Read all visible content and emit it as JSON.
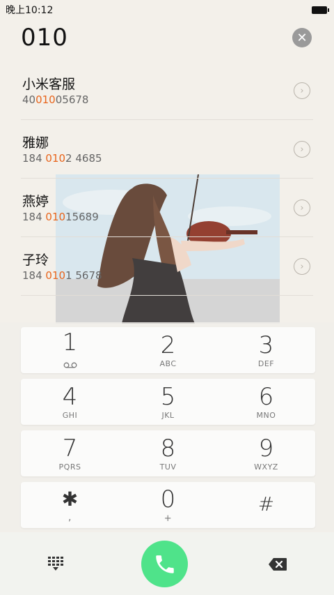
{
  "status_bar": {
    "time": "晚上10:12"
  },
  "dial_input": {
    "value": "010"
  },
  "contacts": [
    {
      "name": "小米客服",
      "num_pre": "40",
      "num_hl": "010",
      "num_post": "05678"
    },
    {
      "name": "雅娜",
      "num_pre": "184 ",
      "num_hl": "010",
      "num_post": "2 4685"
    },
    {
      "name": "燕婷",
      "num_pre": "184 ",
      "num_hl": "010",
      "num_post": "15689"
    },
    {
      "name": "子玲",
      "num_pre": "184 ",
      "num_hl": "010",
      "num_post": "1 5678"
    }
  ],
  "keypad": {
    "rows": [
      [
        {
          "digit": "1",
          "letters": ""
        },
        {
          "digit": "2",
          "letters": "ABC"
        },
        {
          "digit": "3",
          "letters": "DEF"
        }
      ],
      [
        {
          "digit": "4",
          "letters": "GHI"
        },
        {
          "digit": "5",
          "letters": "JKL"
        },
        {
          "digit": "6",
          "letters": "MNO"
        }
      ],
      [
        {
          "digit": "7",
          "letters": "PQRS"
        },
        {
          "digit": "8",
          "letters": "TUV"
        },
        {
          "digit": "9",
          "letters": "WXYZ"
        }
      ],
      [
        {
          "digit": "✱",
          "letters": ","
        },
        {
          "digit": "0",
          "letters": "+"
        },
        {
          "digit": "#",
          "letters": ""
        }
      ]
    ]
  },
  "colors": {
    "highlight": "#e8641b",
    "call_button": "#4fe38a"
  },
  "icons": {
    "clear": "close-icon",
    "arrow": "chevron-right-icon",
    "voicemail": "voicemail-icon",
    "dialpad": "dialpad-icon",
    "call": "phone-icon",
    "backspace": "backspace-icon"
  }
}
